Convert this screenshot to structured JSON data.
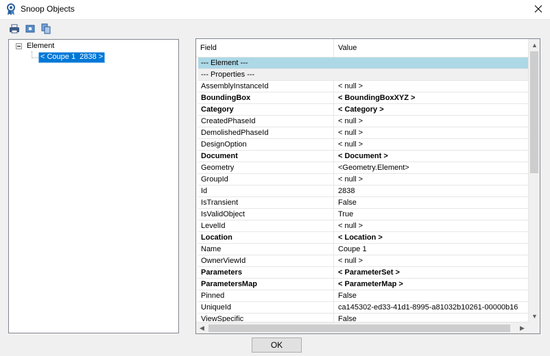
{
  "window": {
    "title": "Snoop Objects",
    "icon": "snoop-badge-icon"
  },
  "toolbar": {
    "buttons": [
      {
        "name": "print-icon"
      },
      {
        "name": "print-preview-icon"
      },
      {
        "name": "copy-icon"
      }
    ]
  },
  "tree": {
    "root": "Element",
    "child": "< Coupe 1  2838 >"
  },
  "grid": {
    "headers": {
      "field": "Field",
      "value": "Value"
    },
    "rows": [
      {
        "field": "--- Element ---",
        "value": "",
        "type": "section"
      },
      {
        "field": "   --- Properties ---",
        "value": "",
        "type": "subsection"
      },
      {
        "field": "AssemblyInstanceId",
        "value": "< null >",
        "type": "normal"
      },
      {
        "field": "BoundingBox",
        "value": "< BoundingBoxXYZ >",
        "type": "bold"
      },
      {
        "field": "Category",
        "value": "< Category >",
        "type": "bold"
      },
      {
        "field": "CreatedPhaseId",
        "value": "< null >",
        "type": "normal"
      },
      {
        "field": "DemolishedPhaseId",
        "value": "< null >",
        "type": "normal"
      },
      {
        "field": "DesignOption",
        "value": "< null >",
        "type": "normal"
      },
      {
        "field": "Document",
        "value": "< Document >",
        "type": "bold"
      },
      {
        "field": "Geometry",
        "value": "<Geometry.Element>",
        "type": "normal"
      },
      {
        "field": "GroupId",
        "value": "< null >",
        "type": "normal"
      },
      {
        "field": "Id",
        "value": "2838",
        "type": "normal"
      },
      {
        "field": "IsTransient",
        "value": "False",
        "type": "normal"
      },
      {
        "field": "IsValidObject",
        "value": "True",
        "type": "normal"
      },
      {
        "field": "LevelId",
        "value": "< null >",
        "type": "normal"
      },
      {
        "field": "Location",
        "value": "< Location >",
        "type": "bold"
      },
      {
        "field": "Name",
        "value": "Coupe 1",
        "type": "normal"
      },
      {
        "field": "OwnerViewId",
        "value": "< null >",
        "type": "normal"
      },
      {
        "field": "Parameters",
        "value": "< ParameterSet >",
        "type": "bold"
      },
      {
        "field": "ParametersMap",
        "value": "< ParameterMap >",
        "type": "bold"
      },
      {
        "field": "Pinned",
        "value": "False",
        "type": "normal"
      },
      {
        "field": "UniqueId",
        "value": "ca145302-ed33-41d1-8995-a81032b10261-00000b16",
        "type": "normal"
      },
      {
        "field": "ViewSpecific",
        "value": "False",
        "type": "normal"
      }
    ]
  },
  "buttons": {
    "ok": "OK"
  },
  "colors": {
    "selection": "#0078d7",
    "section_row": "#add8e6",
    "subsection_row": "#f0f0f0"
  }
}
